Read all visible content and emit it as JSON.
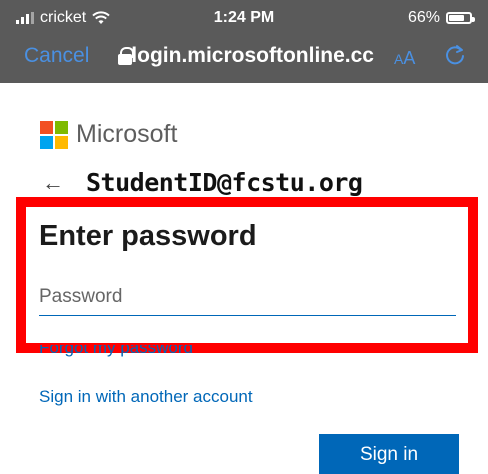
{
  "status_bar": {
    "carrier": "cricket",
    "time": "1:24 PM",
    "battery": "66%",
    "battery_level": 0.66
  },
  "browser": {
    "cancel_label": "Cancel",
    "url": "login.microsoftonline.cc",
    "text_size_label_small": "A",
    "text_size_label_large": "A",
    "accent": "#4a90e2"
  },
  "page": {
    "brand": "Microsoft",
    "identity": "StudentID@fcstu.org",
    "heading": "Enter password",
    "password_placeholder": "Password",
    "forgot_link": "Forgot my password",
    "other_account_link": "Sign in with another account",
    "signin_button": "Sign in",
    "accent": "#0067b8",
    "highlight_color": "#ff0000"
  }
}
